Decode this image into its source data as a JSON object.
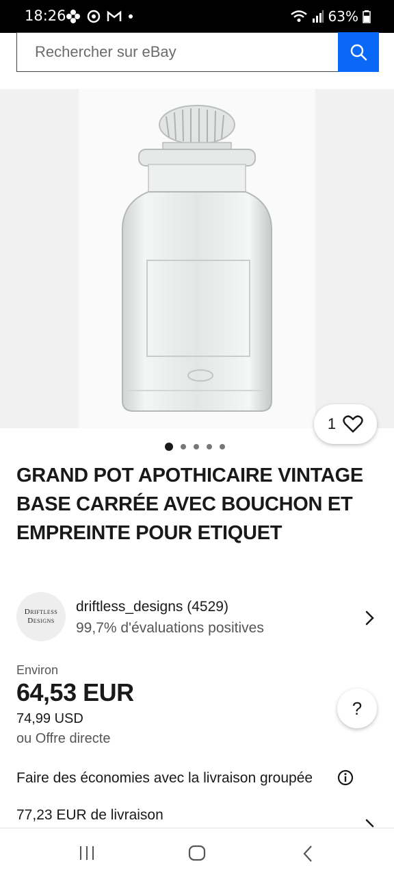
{
  "status_bar": {
    "time": "18:26",
    "battery": "63%",
    "left_icons": [
      "flower-icon",
      "sync-icon",
      "gmail-icon",
      "dot-icon"
    ],
    "right_icons": [
      "wifi-icon",
      "signal-icon",
      "battery-icon"
    ]
  },
  "search": {
    "placeholder": "Rechercher sur eBay",
    "button_icon": "search-icon",
    "accent_color": "#0968f6"
  },
  "gallery": {
    "image_description_icon": "product-photo",
    "dots_total": 5,
    "active_dot": 1,
    "favorite_count": "1",
    "favorite_icon": "heart-icon"
  },
  "item": {
    "title": "GRAND POT APOTHICAIRE VINTAGE BASE CARRÉE AVEC BOUCHON ET EMPREINTE POUR ETIQUET"
  },
  "seller": {
    "logo_line1": "Driftless",
    "logo_line2": "Designs",
    "name": "driftless_designs (4529)",
    "rating": "99,7% d'évaluations positives"
  },
  "price": {
    "label": "Environ",
    "main": "64,53 EUR",
    "original": "74,99 USD",
    "offer": "ou Offre directe",
    "help_label": "?"
  },
  "shipping": {
    "bundle": "Faire des économies avec la livraison groupée",
    "cost": "77,23 EUR de livraison"
  }
}
